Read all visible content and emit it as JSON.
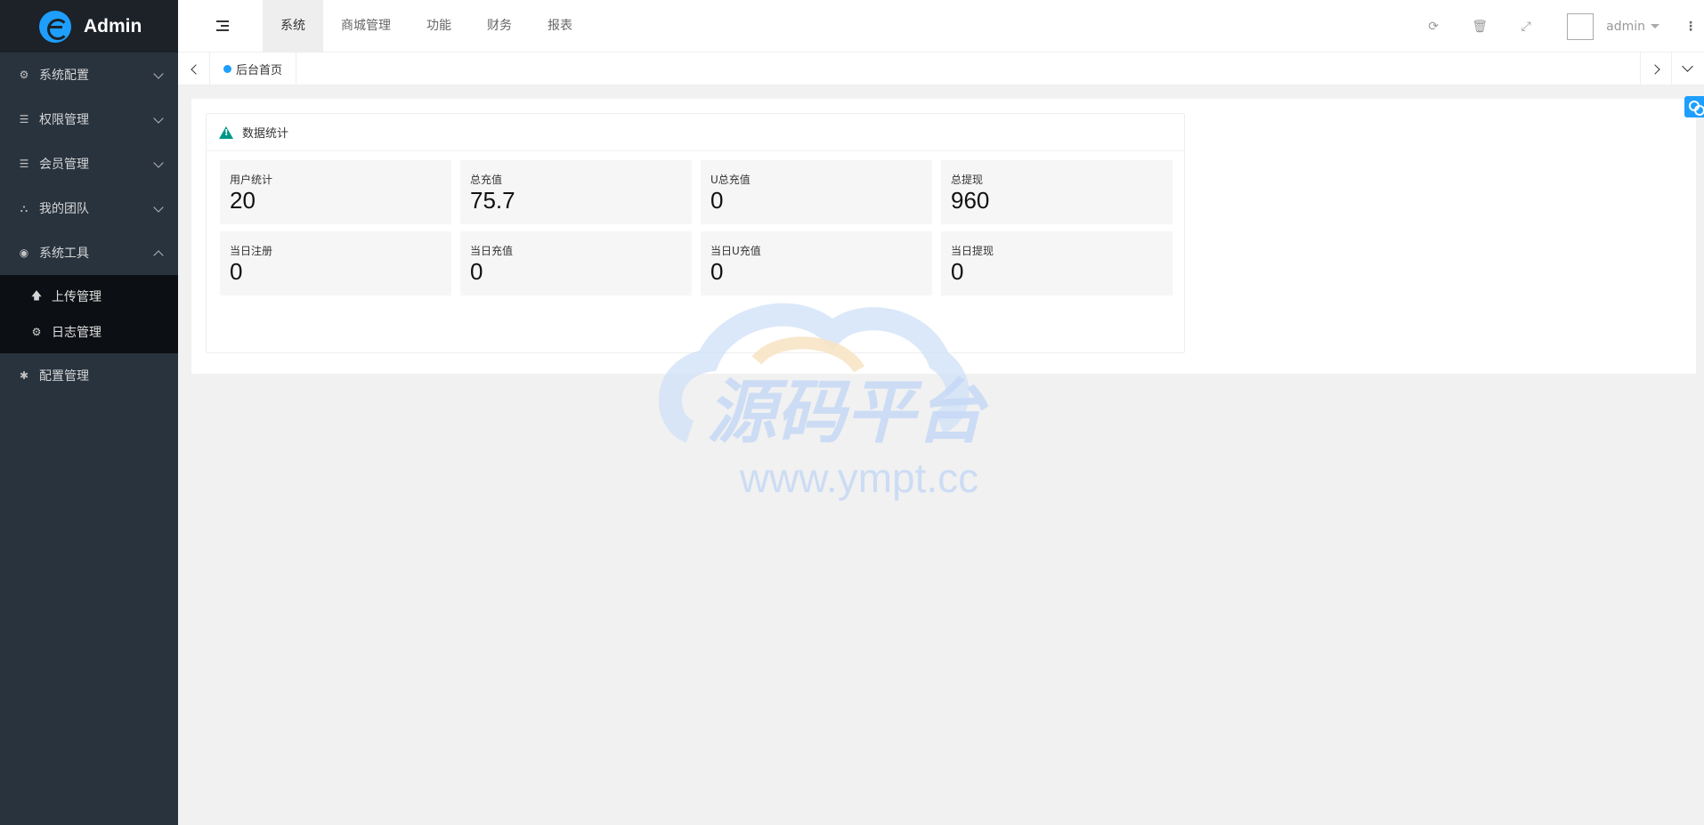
{
  "app": {
    "title": "Admin",
    "brand_color": "#1e9fff"
  },
  "sidebar": {
    "items": [
      {
        "label": "系统配置",
        "icon": "gears-icon"
      },
      {
        "label": "权限管理",
        "icon": "list-icon"
      },
      {
        "label": "会员管理",
        "icon": "list-icon"
      },
      {
        "label": "我的团队",
        "icon": "sitemap-icon"
      },
      {
        "label": "系统工具",
        "icon": "compass-icon",
        "expanded": true
      }
    ],
    "subitems": [
      {
        "label": "上传管理",
        "icon": "arrow-up-icon"
      },
      {
        "label": "日志管理",
        "icon": "gear-icon"
      }
    ],
    "last_item": {
      "label": "配置管理",
      "icon": "asterisk-icon"
    }
  },
  "header": {
    "nav": [
      "系统",
      "商城管理",
      "功能",
      "财务",
      "报表"
    ],
    "active_nav": "系统",
    "user": "admin"
  },
  "tabs": {
    "home": "后台首页"
  },
  "card": {
    "title": "数据统计",
    "stats": [
      {
        "label": "用户统计",
        "value": "20"
      },
      {
        "label": "总充值",
        "value": "75.7"
      },
      {
        "label": "U总充值",
        "value": "0"
      },
      {
        "label": "总提现",
        "value": "960"
      },
      {
        "label": "当日注册",
        "value": "0"
      },
      {
        "label": "当日充值",
        "value": "0"
      },
      {
        "label": "当日U充值",
        "value": "0"
      },
      {
        "label": "当日提现",
        "value": "0"
      }
    ]
  },
  "watermark": {
    "title": "源码平台",
    "url": "www.ympt.cc"
  }
}
